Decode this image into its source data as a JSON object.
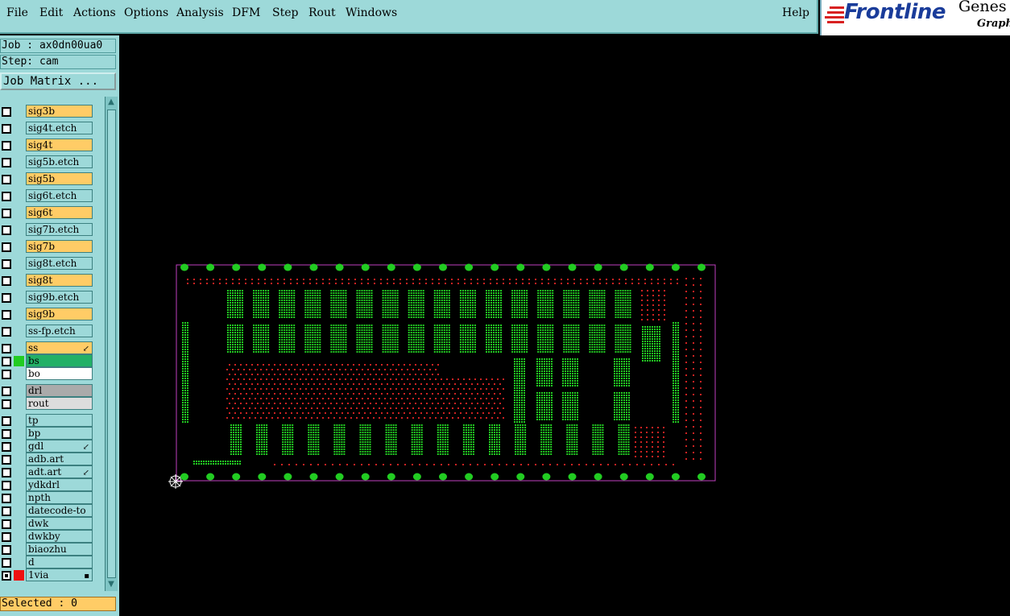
{
  "menubar": {
    "items": [
      "File",
      "Edit",
      "Actions",
      "Options",
      "Analysis",
      "DFM",
      "Step",
      "Rout",
      "Windows"
    ],
    "help": "Help"
  },
  "logo": {
    "brand": "Frontline",
    "product": "Genes",
    "sub": "Graphi"
  },
  "job": {
    "job_line": "Job : ax0dn00ua0",
    "step_line": "Step: cam"
  },
  "job_matrix_label": "Job Matrix ...",
  "layers": [
    {
      "name": "sig3b",
      "color": "#ffcc66"
    },
    {
      "name": "sig4t.etch",
      "color": "#9dd9d9"
    },
    {
      "name": "sig4t",
      "color": "#ffcc66"
    },
    {
      "name": "sig5b.etch",
      "color": "#9dd9d9"
    },
    {
      "name": "sig5b",
      "color": "#ffcc66"
    },
    {
      "name": "sig6t.etch",
      "color": "#9dd9d9"
    },
    {
      "name": "sig6t",
      "color": "#ffcc66"
    },
    {
      "name": "sig7b.etch",
      "color": "#9dd9d9"
    },
    {
      "name": "sig7b",
      "color": "#ffcc66"
    },
    {
      "name": "sig8t.etch",
      "color": "#9dd9d9"
    },
    {
      "name": "sig8t",
      "color": "#ffcc66"
    },
    {
      "name": "sig9b.etch",
      "color": "#9dd9d9"
    },
    {
      "name": "sig9b",
      "color": "#ffcc66"
    },
    {
      "name": "ss-fp.etch",
      "color": "#9dd9d9"
    },
    {
      "name": "ss",
      "color": "#ffcc66"
    },
    {
      "name": "bs",
      "color": "#22b066"
    },
    {
      "name": "bo",
      "color": "#ffffff"
    },
    {
      "name": "drl",
      "color": "#aaaaaa"
    },
    {
      "name": "rout",
      "color": "#dddddd"
    },
    {
      "name": "tp",
      "color": "#9dd9d9"
    },
    {
      "name": "bp",
      "color": "#9dd9d9"
    },
    {
      "name": "gdl",
      "color": "#9dd9d9"
    },
    {
      "name": "adb.art",
      "color": "#9dd9d9"
    },
    {
      "name": "adt.art",
      "color": "#9dd9d9"
    },
    {
      "name": "ydkdrl",
      "color": "#9dd9d9"
    },
    {
      "name": "npth",
      "color": "#9dd9d9"
    },
    {
      "name": "datecode-to",
      "color": "#9dd9d9"
    },
    {
      "name": "dwk",
      "color": "#9dd9d9"
    },
    {
      "name": "dwkby",
      "color": "#9dd9d9"
    },
    {
      "name": "biaozhu",
      "color": "#9dd9d9"
    },
    {
      "name": "d",
      "color": "#9dd9d9"
    },
    {
      "name": "1via",
      "color": "#9dd9d9"
    }
  ],
  "status": {
    "selected": "Selected : 0"
  },
  "colors": {
    "panel": "#9dd9d9",
    "signal_layer": "#ffcc66",
    "pad_green": "#22cc22",
    "outline": "#c040c0",
    "hole_red": "#cc2222"
  }
}
